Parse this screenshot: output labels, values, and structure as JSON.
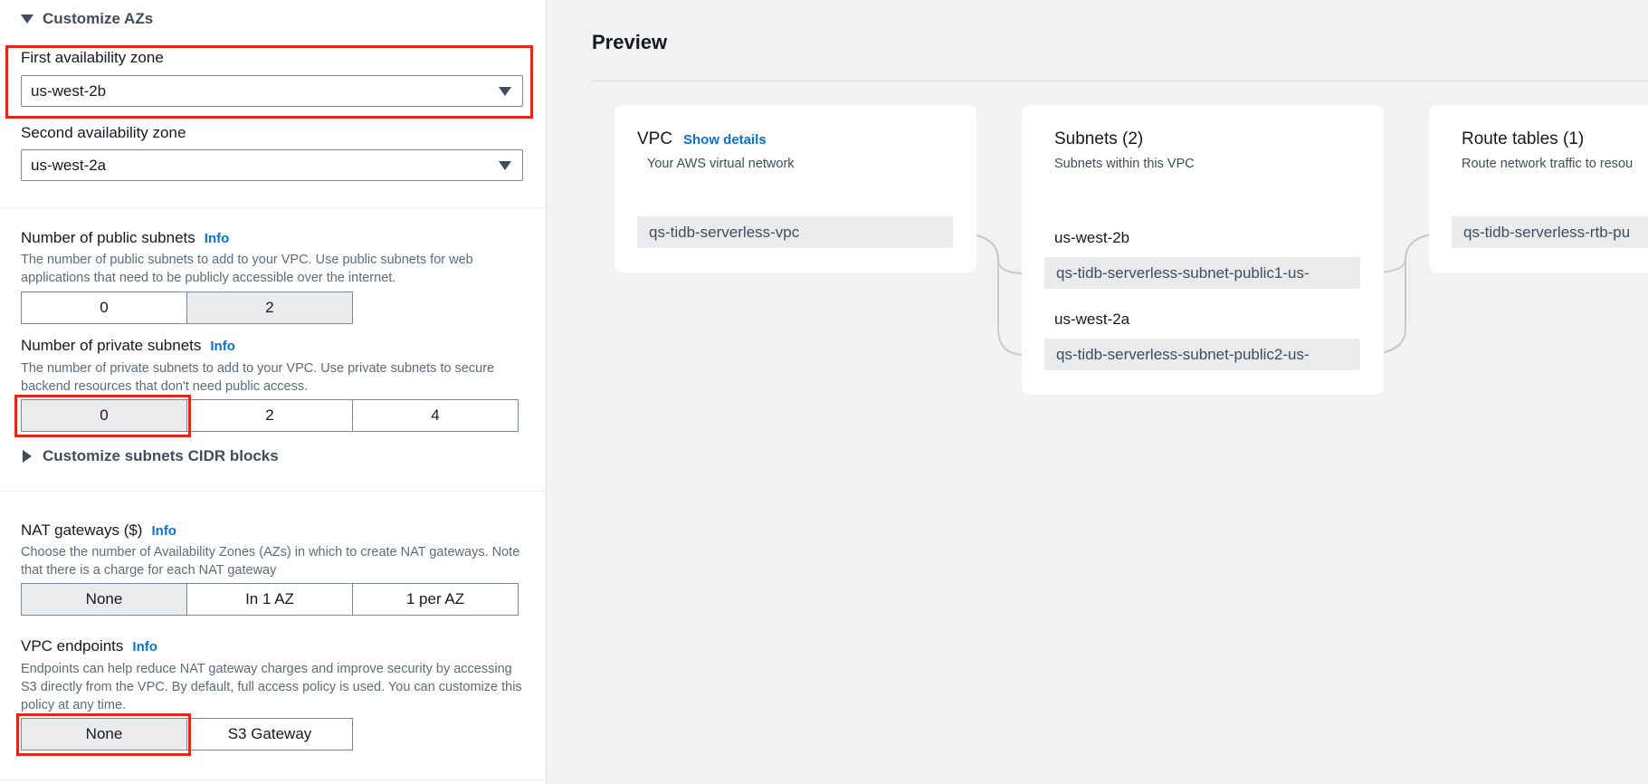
{
  "customize_azs": {
    "label": "Customize AZs"
  },
  "first_az": {
    "label": "First availability zone",
    "value": "us-west-2b"
  },
  "second_az": {
    "label": "Second availability zone",
    "value": "us-west-2a"
  },
  "public_subnets": {
    "label": "Number of public subnets",
    "info": "Info",
    "description": "The number of public subnets to add to your VPC. Use public subnets for web applications that need to be publicly accessible over the internet.",
    "options": [
      "0",
      "2"
    ],
    "selected": "2"
  },
  "private_subnets": {
    "label": "Number of private subnets",
    "info": "Info",
    "description": "The number of private subnets to add to your VPC. Use private subnets to secure backend resources that don't need public access.",
    "options": [
      "0",
      "2",
      "4"
    ],
    "selected": "0"
  },
  "customize_cidr": {
    "label": "Customize subnets CIDR blocks"
  },
  "nat_gateways": {
    "label": "NAT gateways ($)",
    "info": "Info",
    "description": "Choose the number of Availability Zones (AZs) in which to create NAT gateways. Note that there is a charge for each NAT gateway",
    "options": [
      "None",
      "In 1 AZ",
      "1 per AZ"
    ],
    "selected": "None"
  },
  "vpc_endpoints": {
    "label": "VPC endpoints",
    "info": "Info",
    "description": "Endpoints can help reduce NAT gateway charges and improve security by accessing S3 directly from the VPC. By default, full access policy is used. You can customize this policy at any time.",
    "options": [
      "None",
      "S3 Gateway"
    ],
    "selected": "None"
  },
  "preview": {
    "title": "Preview",
    "vpc_card": {
      "title": "VPC",
      "show_details": "Show details",
      "subtitle": "Your AWS virtual network",
      "resource": "qs-tidb-serverless-vpc"
    },
    "subnets_card": {
      "title": "Subnets (2)",
      "subtitle": "Subnets within this VPC",
      "groups": [
        {
          "az": "us-west-2b",
          "subnet": "qs-tidb-serverless-subnet-public1-us-"
        },
        {
          "az": "us-west-2a",
          "subnet": "qs-tidb-serverless-subnet-public2-us-"
        }
      ]
    },
    "route_tables_card": {
      "title": "Route tables (1)",
      "subtitle": "Route network traffic to resou",
      "resource": "qs-tidb-serverless-rtb-pu"
    }
  },
  "colors": {
    "highlight": "#e0281c",
    "link": "#0972d3",
    "selected_segment": "#e9ebed",
    "preview_background": "#f1f2f1"
  }
}
